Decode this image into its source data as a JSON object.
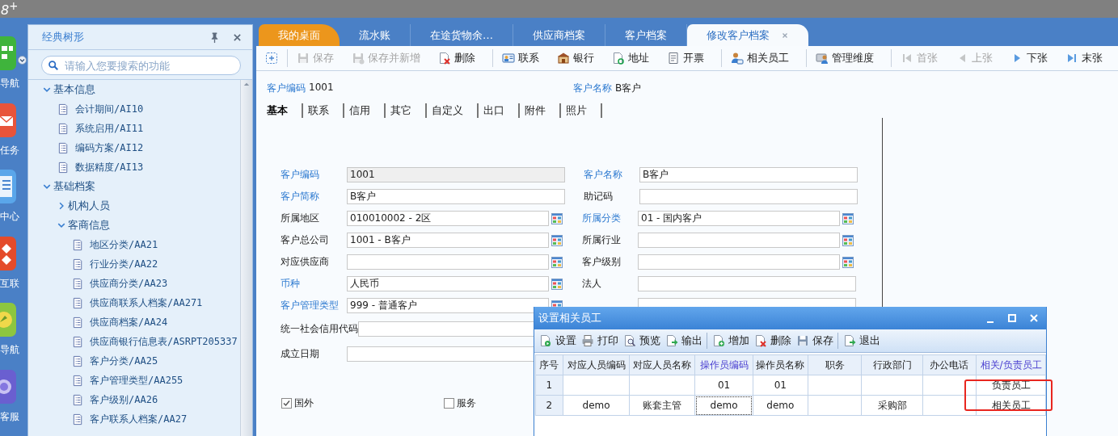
{
  "app_bar": {
    "title": "8$^{+}$"
  },
  "rail": [
    {
      "label": "导航",
      "kind": "nav",
      "dropdown": true
    },
    {
      "label": "任务",
      "kind": "task",
      "dropdown": false
    },
    {
      "label": "中心",
      "kind": "center",
      "dropdown": false
    },
    {
      "label": "互联",
      "kind": "link",
      "dropdown": false
    },
    {
      "label": "导航",
      "kind": "guide",
      "dropdown": false
    },
    {
      "label": "客服",
      "kind": "service",
      "dropdown": false
    }
  ],
  "sidebar": {
    "title": "经典树形",
    "search": {
      "placeholder": "请输入您要搜索的功能"
    },
    "tree": [
      {
        "label": "基本信息",
        "kind": "folder",
        "expanded": true,
        "children": [
          {
            "label": "会计期间/AI10",
            "kind": "leaf"
          },
          {
            "label": "系统启用/AI11",
            "kind": "leaf"
          },
          {
            "label": "编码方案/AI12",
            "kind": "leaf"
          },
          {
            "label": "数据精度/AI13",
            "kind": "leaf"
          }
        ]
      },
      {
        "label": "基础档案",
        "kind": "folder",
        "expanded": true,
        "children": [
          {
            "label": "机构人员",
            "kind": "folder",
            "expanded": false
          },
          {
            "label": "客商信息",
            "kind": "folder",
            "expanded": true,
            "children": [
              {
                "label": "地区分类/AA21",
                "kind": "leaf"
              },
              {
                "label": "行业分类/AA22",
                "kind": "leaf"
              },
              {
                "label": "供应商分类/AA23",
                "kind": "leaf"
              },
              {
                "label": "供应商联系人档案/AA271",
                "kind": "leaf"
              },
              {
                "label": "供应商档案/AA24",
                "kind": "leaf"
              },
              {
                "label": "供应商银行信息表/ASRPT205337",
                "kind": "leaf"
              },
              {
                "label": "客户分类/AA25",
                "kind": "leaf"
              },
              {
                "label": "客户管理类型/AA255",
                "kind": "leaf"
              },
              {
                "label": "客户级别/AA26",
                "kind": "leaf"
              },
              {
                "label": "客户联系人档案/AA27",
                "kind": "leaf"
              }
            ]
          }
        ]
      }
    ]
  },
  "tabs": [
    {
      "label": "我的桌面",
      "kind": "home",
      "selected": false,
      "closable": false
    },
    {
      "label": "流水账",
      "kind": "page",
      "selected": false,
      "closable": false
    },
    {
      "label": "在途货物余…",
      "kind": "page",
      "selected": false,
      "closable": false
    },
    {
      "label": "供应商档案",
      "kind": "page",
      "selected": false,
      "closable": false
    },
    {
      "label": "客户档案",
      "kind": "page",
      "selected": false,
      "closable": false
    },
    {
      "label": "修改客户档案",
      "kind": "page",
      "selected": true,
      "closable": true
    }
  ],
  "toolbar": [
    [
      {
        "kind": "new",
        "disabled": false
      }
    ],
    [
      {
        "kind": "save",
        "label": "保存",
        "disabled": true
      },
      {
        "kind": "savenew",
        "label": "保存并新增",
        "disabled": true
      },
      {
        "kind": "delete",
        "label": "删除",
        "disabled": false
      }
    ],
    [
      {
        "kind": "contact",
        "label": "联系",
        "disabled": false
      },
      {
        "kind": "bank",
        "label": "银行",
        "disabled": false
      },
      {
        "kind": "address",
        "label": "地址",
        "disabled": false
      },
      {
        "kind": "invoice",
        "label": "开票",
        "disabled": false
      }
    ],
    [
      {
        "kind": "staff",
        "label": "相关员工",
        "disabled": false
      }
    ],
    [
      {
        "kind": "dimension",
        "label": "管理维度",
        "disabled": false
      }
    ],
    [
      {
        "kind": "first",
        "label": "首张",
        "disabled": true
      },
      {
        "kind": "prev",
        "label": "上张",
        "disabled": true
      },
      {
        "kind": "next",
        "label": "下张",
        "disabled": false
      },
      {
        "kind": "last",
        "label": "末张",
        "disabled": false
      }
    ]
  ],
  "record_header": [
    {
      "label": "客户编码",
      "value": "1001"
    },
    {
      "label": "客户名称",
      "value": "B客户"
    }
  ],
  "form_tabs": [
    {
      "label": "基本",
      "selected": true
    },
    {
      "label": "联系",
      "selected": false
    },
    {
      "label": "信用",
      "selected": false
    },
    {
      "label": "其它",
      "selected": false
    },
    {
      "label": "自定义",
      "selected": false
    },
    {
      "label": "出口",
      "selected": false
    },
    {
      "label": "附件",
      "selected": false
    },
    {
      "label": "照片",
      "selected": false
    }
  ],
  "form": {
    "rows": [
      {
        "left": {
          "label": "客户编码",
          "value": "1001",
          "required": true,
          "readonly": true,
          "picker": false
        },
        "right": {
          "label": "客户名称",
          "value": "B客户",
          "required": true,
          "readonly": false,
          "picker": false
        }
      },
      {
        "left": {
          "label": "客户简称",
          "value": "B客户",
          "required": true,
          "readonly": false,
          "picker": false
        },
        "right": {
          "label": "助记码",
          "required": false,
          "readonly": false,
          "picker": false
        }
      },
      {
        "left": {
          "label": "所属地区",
          "value": "010010002 - 2区",
          "required": false,
          "readonly": false,
          "picker": true
        },
        "right": {
          "label": "所属分类",
          "value": "01 - 国内客户",
          "required": true,
          "readonly": false,
          "picker": true
        }
      },
      {
        "left": {
          "label": "客户总公司",
          "value": "1001 - B客户",
          "required": false,
          "readonly": false,
          "picker": true
        },
        "right": {
          "label": "所属行业",
          "required": false,
          "readonly": false,
          "picker": true
        }
      },
      {
        "left": {
          "label": "对应供应商",
          "required": false,
          "readonly": false,
          "picker": true
        },
        "right": {
          "label": "客户级别",
          "required": false,
          "readonly": false,
          "picker": true
        }
      },
      {
        "left": {
          "label": "币种",
          "value": "人民币",
          "required": true,
          "readonly": false,
          "picker": true
        },
        "right": {
          "label": "法人",
          "required": false,
          "readonly": false,
          "picker": false
        }
      },
      {
        "left": {
          "label": "客户管理类型",
          "value": "999 - 普通客户",
          "required": true,
          "readonly": false,
          "picker": true
        },
        "right": {
          "readonly": false,
          "picker": false
        }
      },
      {
        "left": {
          "label": "统一社会信用代码",
          "required": false,
          "readonly": false,
          "picker": false
        }
      },
      {
        "left": {
          "label": "成立日期",
          "required": false,
          "readonly": false,
          "picker": false
        }
      }
    ],
    "checkboxes": [
      {
        "label": "国外",
        "checked": true
      },
      {
        "label": "服务",
        "checked": false
      }
    ]
  },
  "dialog": {
    "title": "设置相关员工",
    "toolbar": [
      [
        {
          "kind": "settings",
          "label": "设置"
        },
        {
          "kind": "print",
          "label": "打印"
        },
        {
          "kind": "preview",
          "label": "预览"
        },
        {
          "kind": "export",
          "label": "输出"
        }
      ],
      [
        {
          "kind": "add",
          "label": "增加"
        },
        {
          "kind": "delete",
          "label": "删除"
        },
        {
          "kind": "save",
          "label": "保存"
        }
      ],
      [
        {
          "kind": "exit",
          "label": "退出"
        }
      ]
    ],
    "table": {
      "columns": [
        {
          "label": "序号",
          "highlighted": false,
          "marked": false
        },
        {
          "label": "对应人员编码",
          "highlighted": false,
          "marked": false
        },
        {
          "label": "对应人员名称",
          "highlighted": false,
          "marked": false
        },
        {
          "label": "操作员编码",
          "highlighted": true,
          "marked": false
        },
        {
          "label": "操作员名称",
          "highlighted": false,
          "marked": false
        },
        {
          "label": "职务",
          "highlighted": false,
          "marked": false
        },
        {
          "label": "行政部门",
          "highlighted": false,
          "marked": false
        },
        {
          "label": "办公电话",
          "highlighted": false,
          "marked": false
        },
        {
          "label": "相关/负责员工",
          "highlighted": true,
          "marked": true
        }
      ],
      "rows": [
        {
          "cells": [
            {
              "text": "1",
              "focused": false
            },
            {
              "focused": false
            },
            {
              "focused": false
            },
            {
              "text": "01",
              "focused": false
            },
            {
              "text": "01",
              "focused": false
            },
            {
              "focused": false
            },
            {
              "focused": false
            },
            {
              "focused": false
            },
            {
              "text": "负责员工",
              "focused": false
            }
          ]
        },
        {
          "cells": [
            {
              "text": "2",
              "focused": false
            },
            {
              "text": "demo",
              "focused": false
            },
            {
              "text": "账套主管",
              "focused": false
            },
            {
              "text": "demo",
              "focused": true
            },
            {
              "text": "demo",
              "focused": false
            },
            {
              "focused": false
            },
            {
              "text": "采购部",
              "focused": false
            },
            {
              "focused": false
            },
            {
              "text": "相关员工",
              "focused": false
            }
          ]
        }
      ]
    }
  }
}
